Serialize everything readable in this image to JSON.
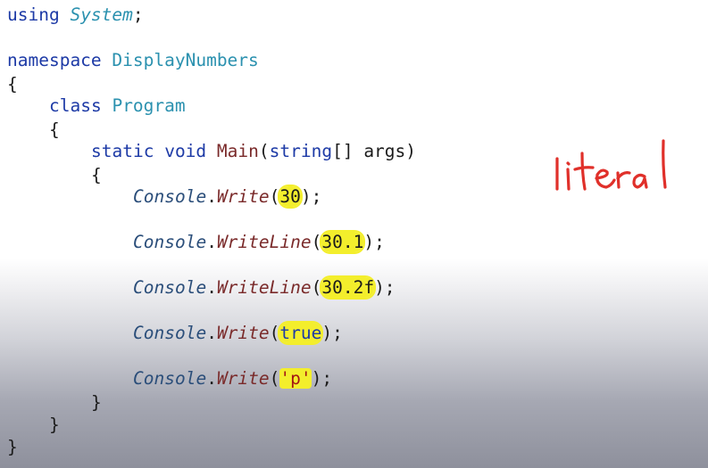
{
  "code": {
    "using_keyword": "using",
    "using_namespace": "System",
    "semicolon": ";",
    "namespace_keyword": "namespace",
    "namespace_name": "DisplayNumbers",
    "open_brace": "{",
    "close_brace": "}",
    "class_keyword": "class",
    "class_name": "Program",
    "static_keyword": "static",
    "void_keyword": "void",
    "main_name": "Main",
    "main_params_open": "(",
    "string_type": "string",
    "main_params_rest": "[] args)",
    "console_obj": "Console",
    "dot": ".",
    "paren_open": "(",
    "paren_close_semicolon": ");",
    "statements": [
      {
        "method": "Write",
        "literal": "30"
      },
      {
        "method": "WriteLine",
        "literal": "30.1"
      },
      {
        "method": "WriteLine",
        "literal": "30.2f"
      },
      {
        "method": "Write",
        "literal": "true"
      },
      {
        "method": "Write",
        "literal": "'p'"
      }
    ]
  },
  "annotation": {
    "text": "literal",
    "color": "#e0302a"
  },
  "colors": {
    "keyword": "#1d3aa6",
    "type": "#2b91af",
    "method": "#7a2a2a",
    "highlight": "#f3ee2c"
  }
}
